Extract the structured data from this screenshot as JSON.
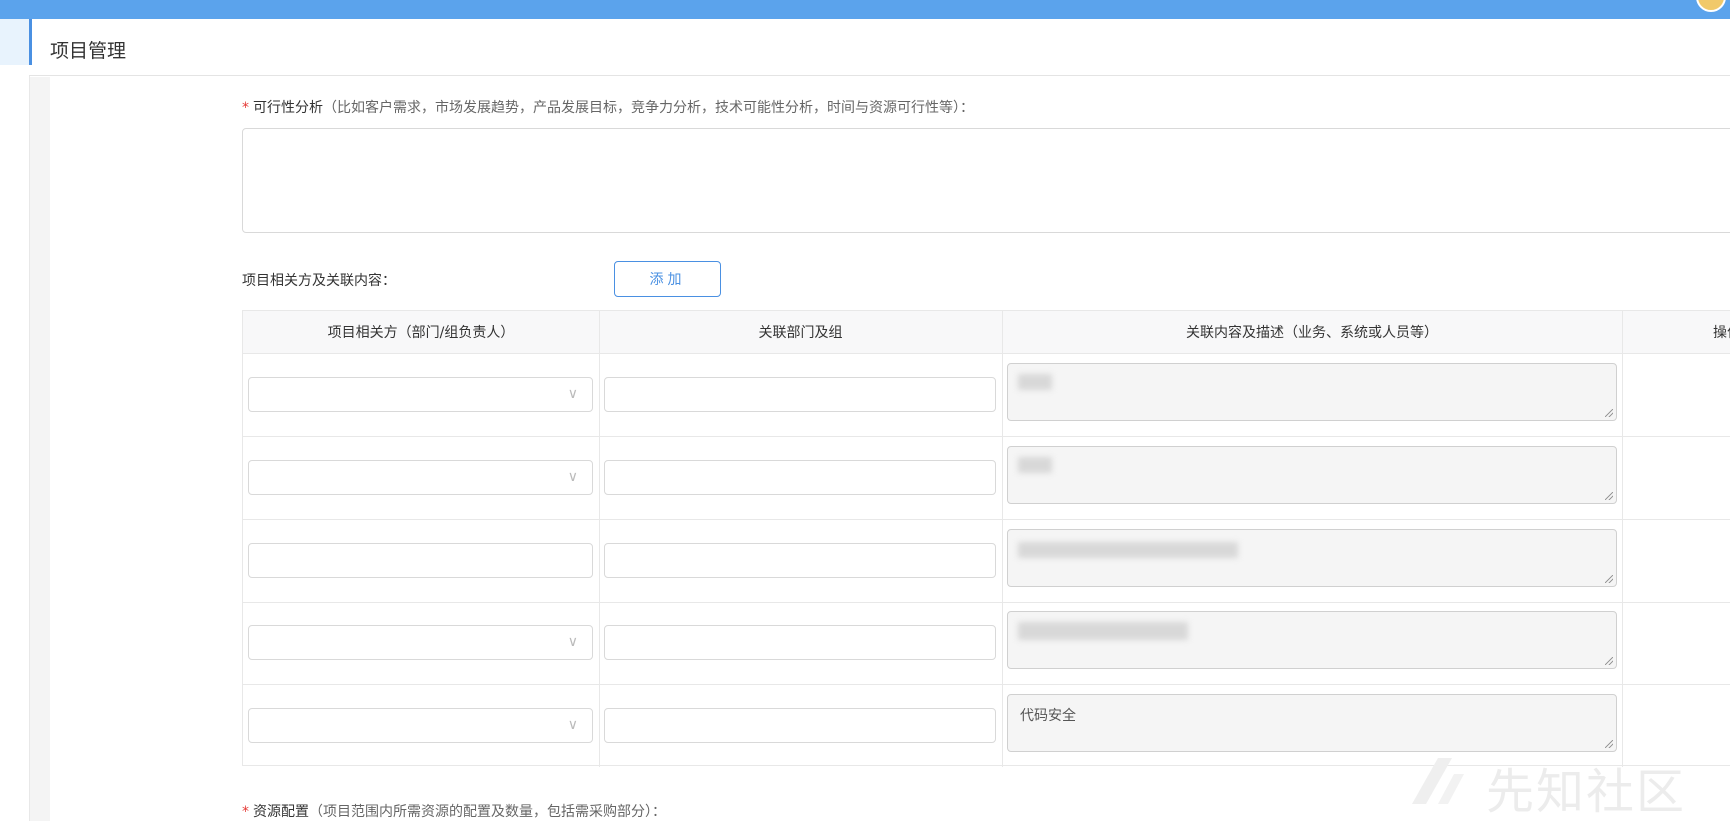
{
  "page": {
    "title": "项目管理"
  },
  "feasibility": {
    "required_mark": "*",
    "label": "可行性分析",
    "hint": "（比如客户需求，市场发展趋势，产品发展目标，竞争力分析，技术可能性分析，时间与资源可行性等）：",
    "value": ""
  },
  "stakeholders": {
    "label": "项目相关方及关联内容：",
    "add_label": "添加",
    "columns": [
      "项目相关方（部门/组负责人）",
      "关联部门及组",
      "关联内容及描述（业务、系统或人员等）",
      "操作"
    ],
    "rows": [
      {
        "party": "",
        "dept": "",
        "desc": "",
        "dropdown": true
      },
      {
        "party": "",
        "dept": "",
        "desc": "",
        "dropdown": true
      },
      {
        "party": "",
        "dept": "",
        "desc": "",
        "dropdown": false
      },
      {
        "party": "",
        "dept": "",
        "desc": "",
        "dropdown": true
      },
      {
        "party": "",
        "dept": "",
        "desc": "代码安全",
        "dropdown": true
      }
    ]
  },
  "resources": {
    "required_mark": "*",
    "label": "资源配置",
    "hint": "（项目范围内所需资源的配置及数量，包括需采购部分）："
  },
  "watermark": {
    "text": "先知社区"
  },
  "icons": {
    "dropdown": "chevron-down-icon",
    "avatar": "user-avatar-icon",
    "resize": "resize-grip-icon"
  },
  "colors": {
    "topbar": "#5ba3ec",
    "accent": "#4a90e2",
    "required": "#e53935"
  }
}
